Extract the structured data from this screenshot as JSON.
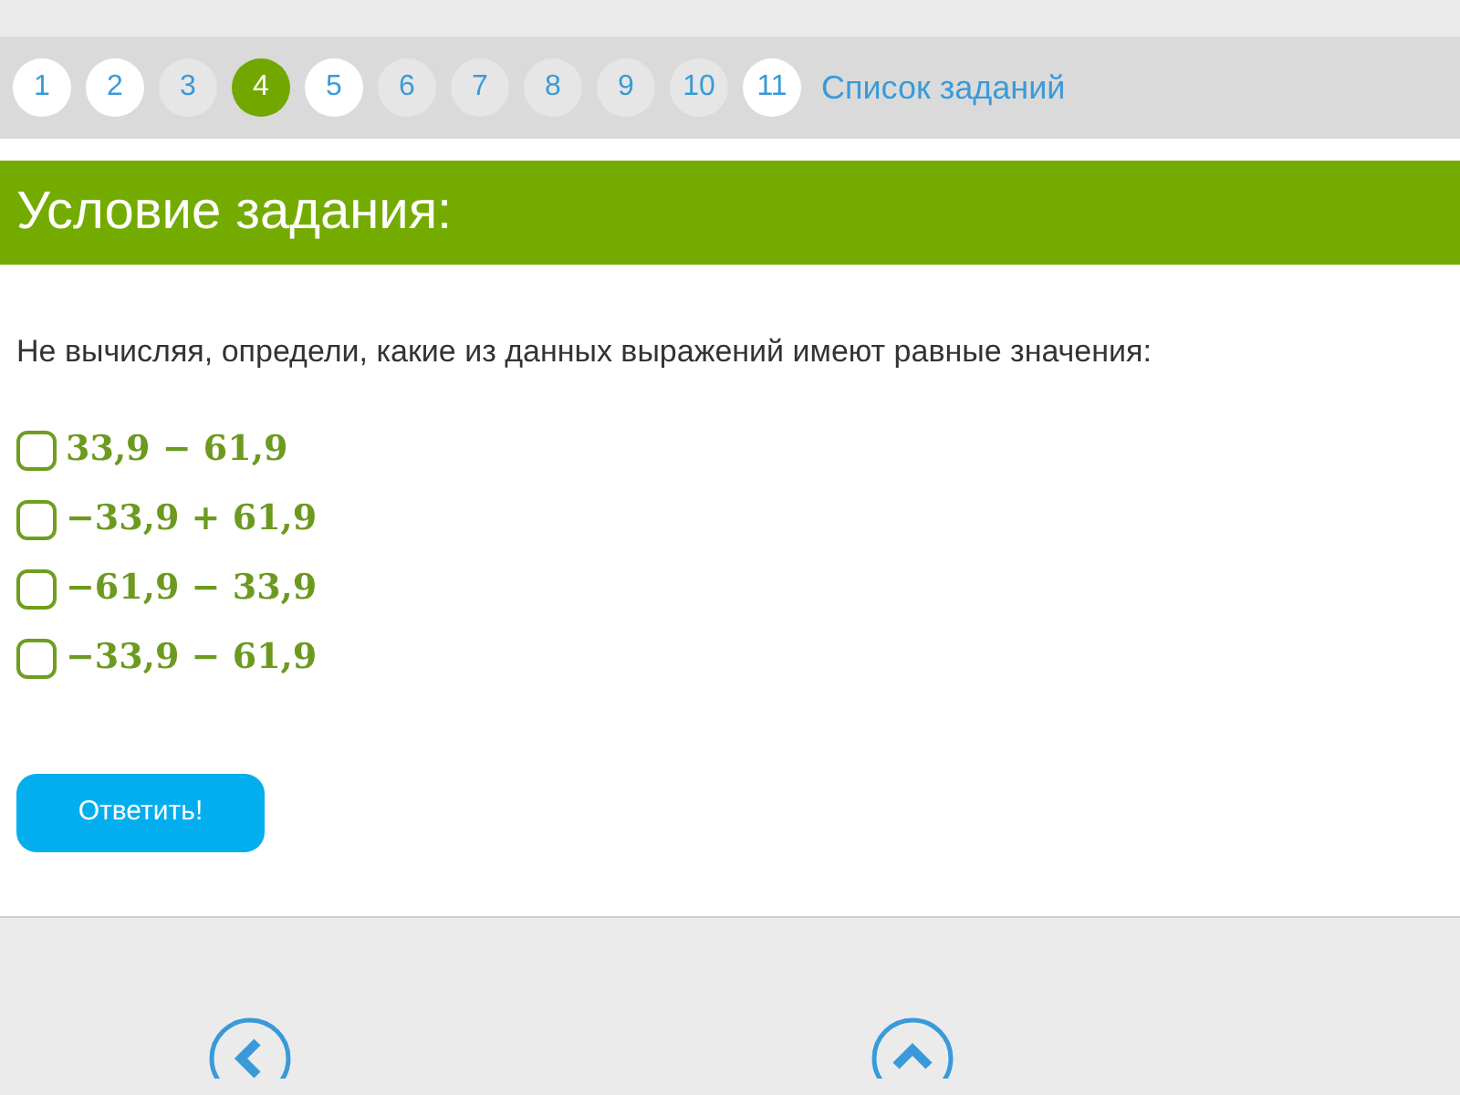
{
  "pagination": [
    {
      "label": "1",
      "selected": false,
      "visited": true
    },
    {
      "label": "2",
      "selected": false,
      "visited": true
    },
    {
      "label": "3",
      "selected": false,
      "visited": false
    },
    {
      "label": "4",
      "selected": true,
      "visited": false
    },
    {
      "label": "5",
      "selected": false,
      "visited": true
    },
    {
      "label": "6",
      "selected": false,
      "visited": false
    },
    {
      "label": "7",
      "selected": false,
      "visited": false
    },
    {
      "label": "8",
      "selected": false,
      "visited": false
    },
    {
      "label": "9",
      "selected": false,
      "visited": false
    },
    {
      "label": "10",
      "selected": false,
      "visited": false
    },
    {
      "label": "11",
      "selected": false,
      "visited": true
    }
  ],
  "task_list_link": "Список заданий",
  "header": "Условие задания:",
  "question": "Не вычисляя, определи, какие из данных выражений имеют равные значения:",
  "options": [
    {
      "text": "33,9 − 61,9",
      "checked": false
    },
    {
      "text": "−33,9 + 61,9",
      "checked": false
    },
    {
      "text": "−61,9 − 33,9",
      "checked": false
    },
    {
      "text": "−33,9 − 61,9",
      "checked": false
    }
  ],
  "submit_button": "Ответить!"
}
